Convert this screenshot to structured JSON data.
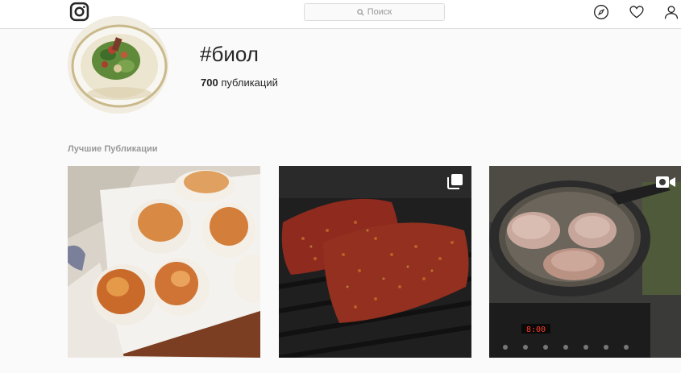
{
  "topbar": {
    "logo_icon": "instagram-logo-icon",
    "search": {
      "placeholder": "Поиск",
      "icon": "search-icon"
    },
    "nav_icons": [
      "compass-icon",
      "heart-icon",
      "profile-icon"
    ]
  },
  "header": {
    "hashtag": "#биол",
    "post_count_number": "700",
    "post_count_label": " публикаций"
  },
  "sections": {
    "top_posts_label": "Лучшие Публикации"
  },
  "posts": [
    {
      "subject": "baked round patties in white dish",
      "badge": ""
    },
    {
      "subject": "seasoned meat on grill pan",
      "badge": "multiple-images-icon"
    },
    {
      "subject": "meat frying in pan on induction stove",
      "badge": "video-camera-icon"
    }
  ],
  "stove_display": "8:00",
  "colors": {
    "topbar_bg": "#ffffff",
    "page_bg": "#fafafa",
    "border": "#dbdbdb",
    "muted_text": "#999999",
    "text": "#262626"
  }
}
